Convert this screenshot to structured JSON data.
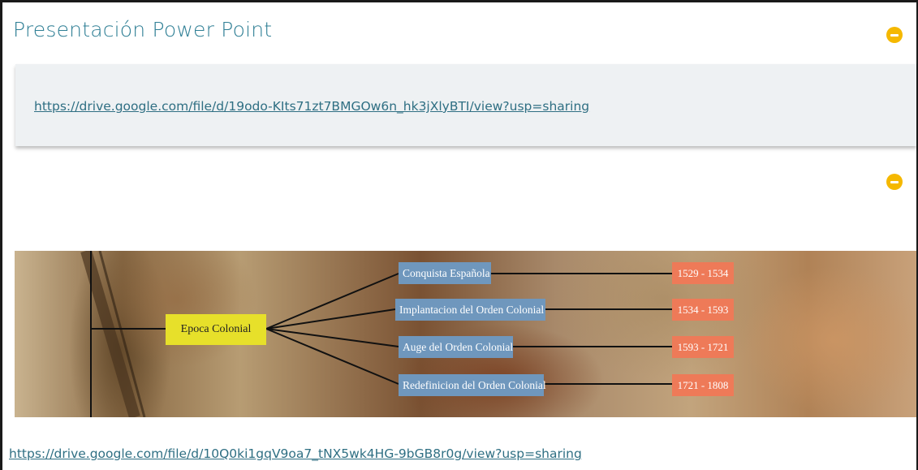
{
  "section_title": "Presentación Power Point",
  "links": {
    "first": "https://drive.google.com/file/d/19odo-KIts71zt7BMGOw6n_hk3jXlyBTI/view?usp=sharing",
    "second": "https://drive.google.com/file/d/10Q0ki1gqV9oa7_tNX5wk4HG-9bGB8r0g/view?usp=sharing"
  },
  "icons": {
    "collapse": "minus-circle-icon"
  },
  "colors": {
    "title": "#2f7f95",
    "link": "#2f6f83",
    "collapse_button": "#f5b800",
    "panel_background": "#eef1f3",
    "root_node": "#e7e02a",
    "period_node": "#6f97bd",
    "year_node": "#ee7a58"
  },
  "timeline": {
    "root": "Epoca Colonial",
    "periods": [
      {
        "label": "Conquista Española",
        "years": "1529 - 1534"
      },
      {
        "label": "Implantacion del Orden Colonial",
        "years": "1534 - 1593"
      },
      {
        "label": "Auge del Orden Colonial",
        "years": "1593 - 1721"
      },
      {
        "label": "Redefinicion del Orden Colonial",
        "years": "1721 - 1808"
      }
    ]
  }
}
